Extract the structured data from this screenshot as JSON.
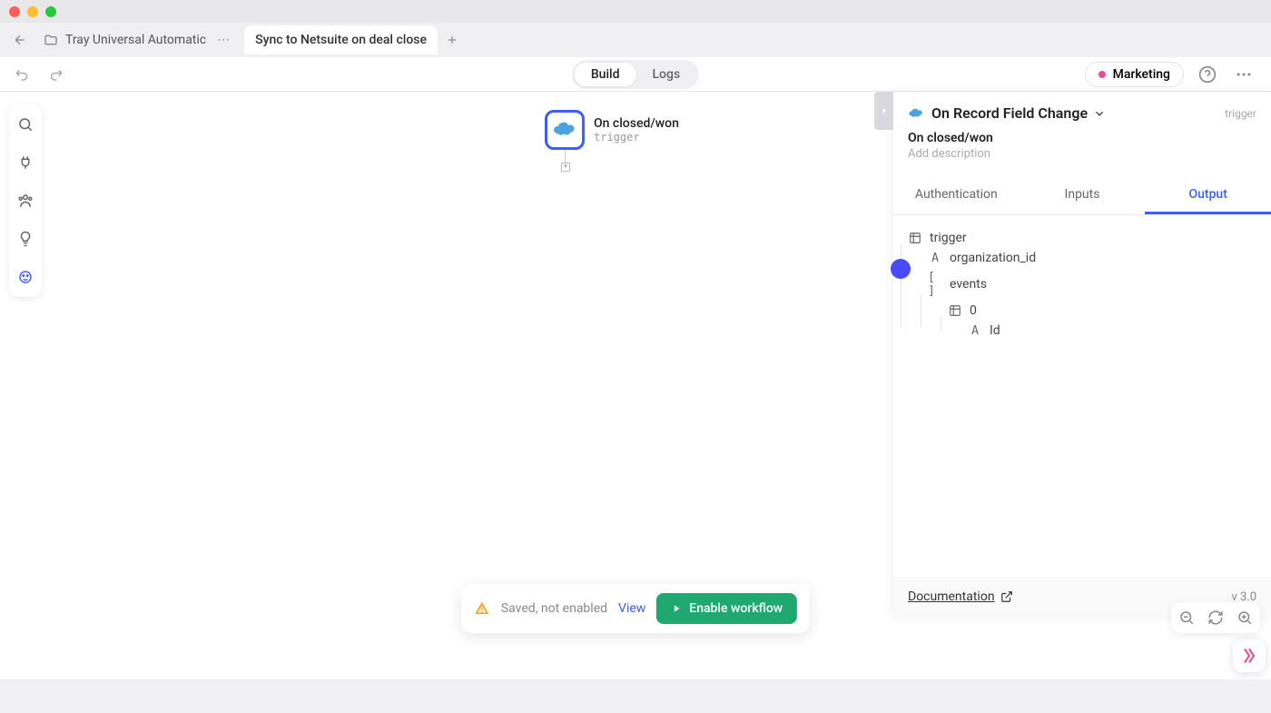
{
  "tabs": {
    "inactive_label": "Tray Universal Automatic",
    "active_label": "Sync to Netsuite on deal close"
  },
  "toolbar": {
    "build": "Build",
    "logs": "Logs",
    "env": "Marketing"
  },
  "node": {
    "title": "On closed/won",
    "subtitle": "trigger"
  },
  "panel": {
    "title": "On Record Field Change",
    "badge": "trigger",
    "name": "On closed/won",
    "description_placeholder": "Add description",
    "tabs": {
      "auth": "Authentication",
      "inputs": "Inputs",
      "output": "Output"
    },
    "tree": {
      "root": "trigger",
      "f1": "organization_id",
      "f2": "events",
      "f3": "0",
      "f4": "Id"
    },
    "doc": "Documentation",
    "version": "v 3.0"
  },
  "status": {
    "text": "Saved, not enabled",
    "view": "View",
    "enable": "Enable workflow"
  }
}
